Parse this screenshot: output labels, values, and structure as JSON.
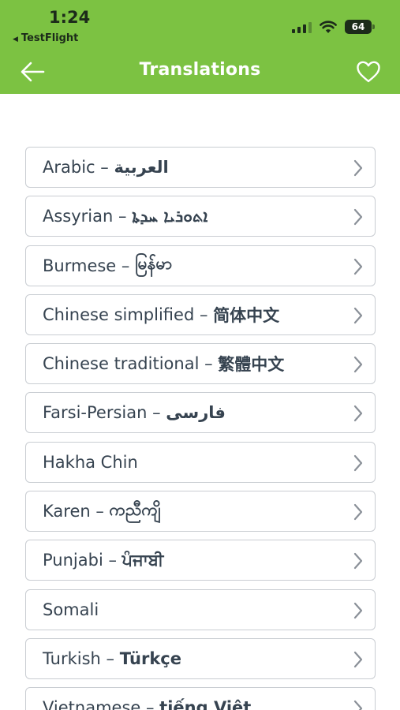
{
  "status_bar": {
    "time": "1:24",
    "back_app": "TestFlight",
    "battery": "64"
  },
  "nav": {
    "title": "Translations",
    "back_icon": "arrow-left-icon",
    "favorite_icon": "heart-icon"
  },
  "languages": [
    {
      "name": "Arabic",
      "native": "العربية"
    },
    {
      "name": "Assyrian",
      "native": "ܐܬܘܪܝܐ ܚܕܬܐ"
    },
    {
      "name": "Burmese",
      "native": "မြန်မာ"
    },
    {
      "name": "Chinese simplified",
      "native": "简体中文"
    },
    {
      "name": "Chinese traditional",
      "native": "繁體中文"
    },
    {
      "name": "Farsi-Persian",
      "native": "فارسی"
    },
    {
      "name": "Hakha Chin",
      "native": ""
    },
    {
      "name": "Karen",
      "native": "ကညီကျိ"
    },
    {
      "name": "Punjabi",
      "native": "ਪੰਜਾਬੀ"
    },
    {
      "name": "Somali",
      "native": ""
    },
    {
      "name": "Turkish",
      "native": "Türkçe"
    },
    {
      "name": "Vietnamese",
      "native": "tiếng Việt"
    }
  ],
  "colors": {
    "header": "#7cc242",
    "row_border": "#c9cdd2",
    "text": "#364350"
  }
}
